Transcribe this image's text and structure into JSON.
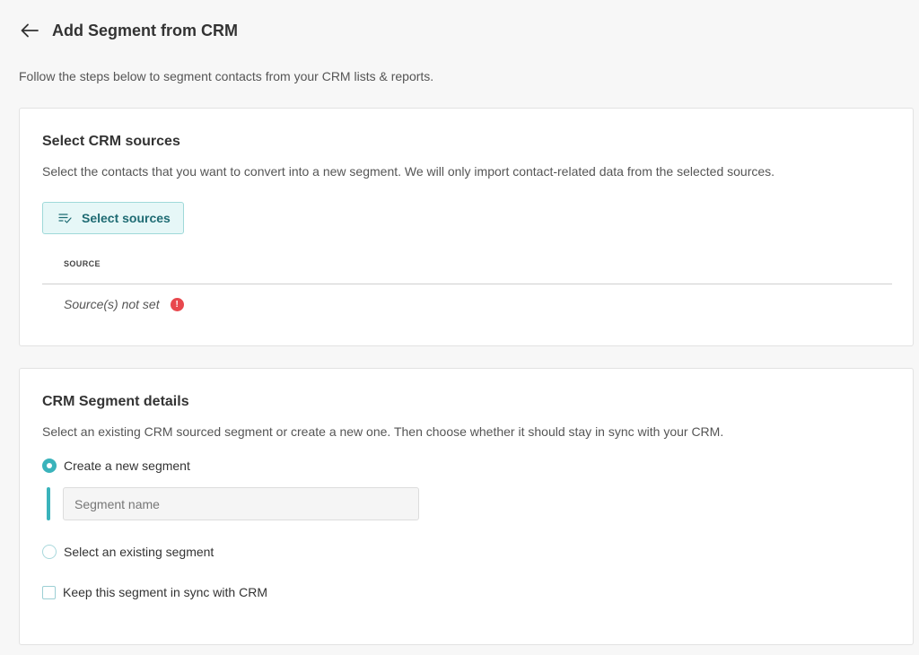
{
  "header": {
    "title": "Add Segment from CRM",
    "back_icon": "arrow-left-icon"
  },
  "intro": "Follow the steps below to segment contacts from your CRM lists & reports.",
  "sources_card": {
    "title": "Select CRM sources",
    "description": "Select the contacts that you want to convert into a new segment. We will only import contact-related data from the selected sources.",
    "button_label": "Select sources",
    "button_icon": "list-check-icon",
    "table": {
      "column": "SOURCE",
      "empty_text": "Source(s) not set",
      "error_icon": "error-icon",
      "error_symbol": "!"
    }
  },
  "details_card": {
    "title": "CRM Segment details",
    "description": "Select an existing CRM sourced segment or create a new one. Then choose whether it should stay in sync with your CRM.",
    "options": [
      {
        "label": "Create a new segment",
        "selected": true
      },
      {
        "label": "Select an existing segment",
        "selected": false
      }
    ],
    "segment_name": {
      "value": "",
      "placeholder": "Segment name"
    },
    "sync_checkbox": {
      "label": "Keep this segment in sync with CRM",
      "checked": false
    }
  },
  "colors": {
    "accent": "#3ab3bb",
    "button_bg": "#e6f7f7",
    "button_text": "#1e6b73",
    "error": "#e8484e"
  }
}
